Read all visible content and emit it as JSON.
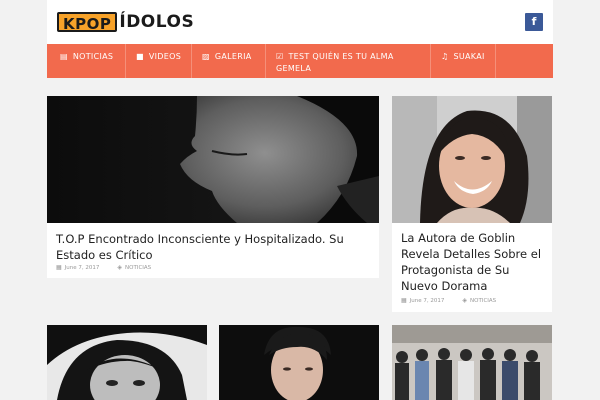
{
  "site": {
    "logo_part1": "KPOP",
    "logo_part2": "ÍDOLOS",
    "facebook_glyph": "f"
  },
  "nav": {
    "items": [
      {
        "label": "NOTICIAS",
        "icon": "newspaper-icon",
        "glyph": "▤"
      },
      {
        "label": "VIDEOS",
        "icon": "video-camera-icon",
        "glyph": "■"
      },
      {
        "label": "GALERIA",
        "icon": "image-icon",
        "glyph": "▨"
      },
      {
        "label": "TEST QUIÉN ES TU ALMA",
        "label2": "GEMELA",
        "icon": "checkbox-icon",
        "glyph": "☑"
      },
      {
        "label": "SUAKAI",
        "icon": "music-note-icon",
        "glyph": "♫"
      }
    ],
    "background": "#f26a4d"
  },
  "posts": [
    {
      "title": "T.O.P Encontrado Inconsciente y Hospitalizado. Su Estado es Crítico",
      "date": "June 7, 2017",
      "category": "NOTICIAS"
    },
    {
      "title": "La Autora de Goblin Revela Detalles Sobre el Protagonista de Su Nuevo Dorama",
      "date": "June 7, 2017",
      "category": "NOTICIAS"
    }
  ],
  "colors": {
    "accent": "#f26a4d",
    "logo_orange": "#f7a229",
    "facebook": "#3b5998",
    "page_bg": "#f2f2f2"
  }
}
